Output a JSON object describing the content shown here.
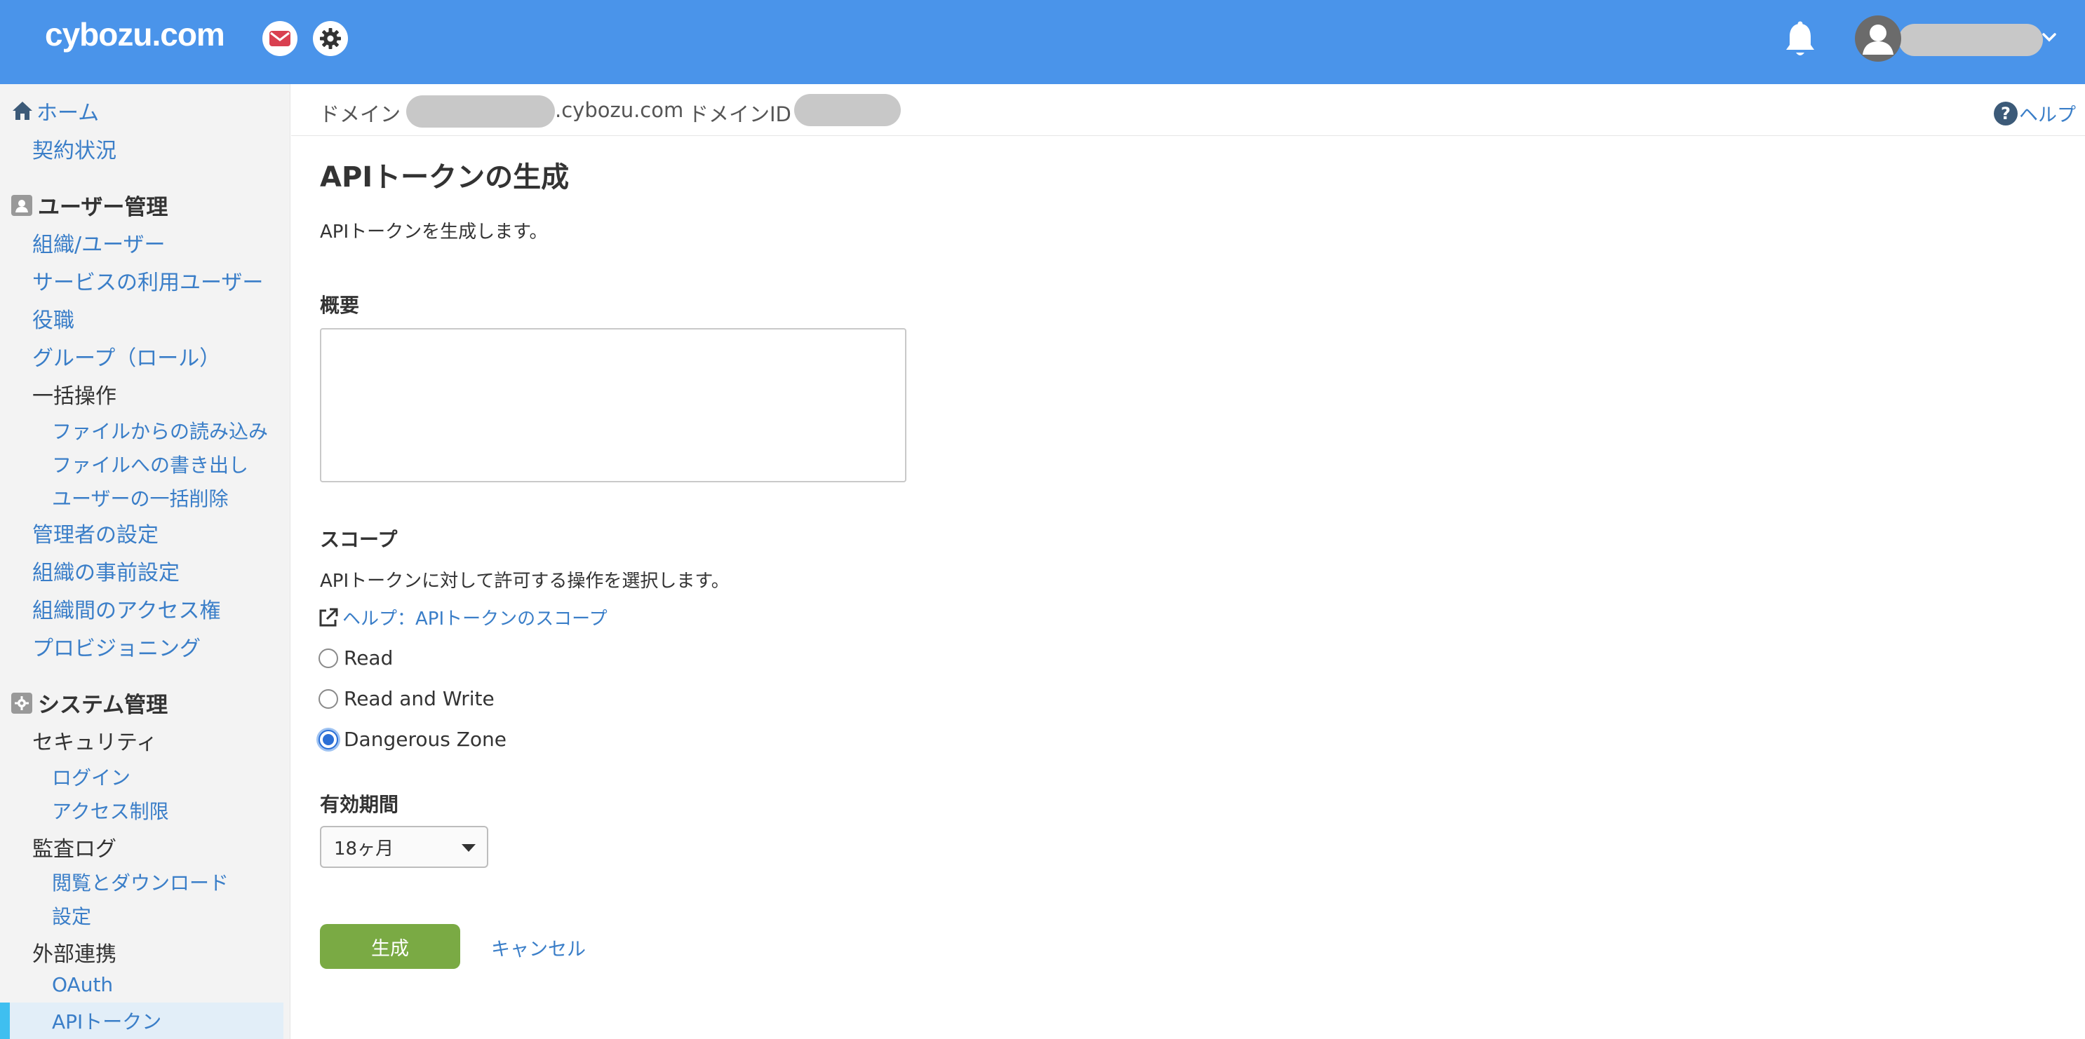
{
  "header": {
    "logo": "cybozu.com"
  },
  "sidebar": {
    "home": "ホーム",
    "contract": "契約状況",
    "user_mgmt": {
      "title": "ユーザー管理",
      "items": [
        "組織/ユーザー",
        "サービスの利用ユーザー",
        "役職",
        "グループ（ロール）",
        "一括操作"
      ],
      "bulk_sub": [
        "ファイルからの読み込み",
        "ファイルへの書き出し",
        "ユーザーの一括削除"
      ],
      "items2": [
        "管理者の設定",
        "組織の事前設定",
        "組織間のアクセス権",
        "プロビジョニング"
      ]
    },
    "system_mgmt": {
      "title": "システム管理",
      "security": "セキュリティ",
      "security_sub": [
        "ログイン",
        "アクセス制限"
      ],
      "audit": "監査ログ",
      "audit_sub": [
        "閲覧とダウンロード",
        "設定"
      ],
      "external": "外部連携",
      "external_sub": [
        "OAuth",
        "APIトークン"
      ]
    }
  },
  "domainbar": {
    "domain_label": "ドメイン",
    "domain_suffix": ".cybozu.com",
    "domain_id_label": "ドメインID",
    "help": "ヘルプ"
  },
  "main": {
    "title": "APIトークンの生成",
    "description": "APIトークンを生成します。",
    "summary_label": "概要",
    "summary_value": "",
    "scope_label": "スコープ",
    "scope_description": "APIトークンに対して許可する操作を選択します。",
    "scope_help_link": "ヘルプ：APIトークンのスコープ",
    "scope_options": [
      "Read",
      "Read and Write",
      "Dangerous Zone"
    ],
    "scope_selected": "Dangerous Zone",
    "expiry_label": "有効期間",
    "expiry_value": "18ヶ月",
    "generate_button": "生成",
    "cancel_link": "キャンセル"
  }
}
